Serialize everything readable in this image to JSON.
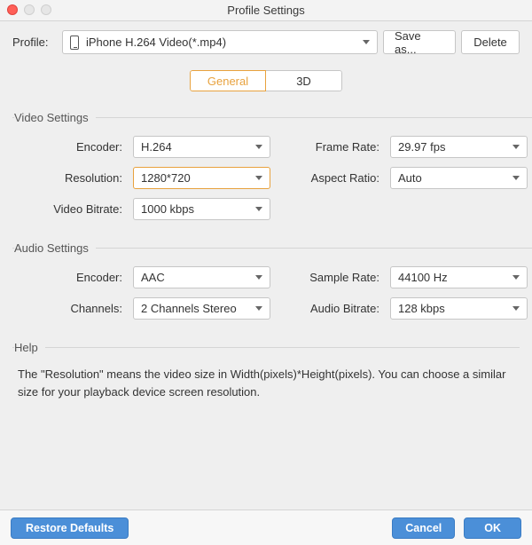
{
  "window": {
    "title": "Profile Settings"
  },
  "profile": {
    "label": "Profile:",
    "selected": "iPhone H.264 Video(*.mp4)",
    "saveas_label": "Save as...",
    "delete_label": "Delete"
  },
  "tabs": {
    "general": "General",
    "threeD": "3D",
    "active": "general"
  },
  "video": {
    "legend": "Video Settings",
    "encoder_label": "Encoder:",
    "encoder_value": "H.264",
    "resolution_label": "Resolution:",
    "resolution_value": "1280*720",
    "framerate_label": "Frame Rate:",
    "framerate_value": "29.97 fps",
    "aspect_label": "Aspect Ratio:",
    "aspect_value": "Auto",
    "bitrate_label": "Video Bitrate:",
    "bitrate_value": "1000 kbps"
  },
  "audio": {
    "legend": "Audio Settings",
    "encoder_label": "Encoder:",
    "encoder_value": "AAC",
    "samplerate_label": "Sample Rate:",
    "samplerate_value": "44100 Hz",
    "channels_label": "Channels:",
    "channels_value": "2 Channels Stereo",
    "bitrate_label": "Audio Bitrate:",
    "bitrate_value": "128 kbps"
  },
  "help": {
    "legend": "Help",
    "text": "The \"Resolution\" means the video size in Width(pixels)*Height(pixels).  You can choose a similar size for your playback device screen resolution."
  },
  "footer": {
    "restore": "Restore Defaults",
    "cancel": "Cancel",
    "ok": "OK"
  }
}
